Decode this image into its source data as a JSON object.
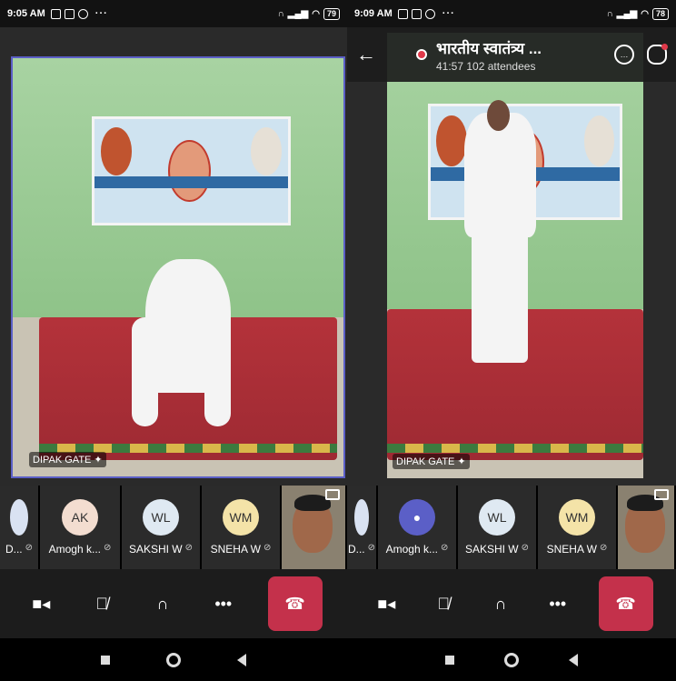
{
  "left": {
    "status": {
      "time": "9:05 AM",
      "battery": "79"
    },
    "video": {
      "name": "DIPAK GATE"
    },
    "participants": [
      {
        "initials": "",
        "name": "D...",
        "color": "#d9e2f2"
      },
      {
        "initials": "AK",
        "name": "Amogh k...",
        "color": "#f3ddd0"
      },
      {
        "initials": "WL",
        "name": "SAKSHI W",
        "color": "#dfe9f2"
      },
      {
        "initials": "WM",
        "name": "SNEHA W",
        "color": "#f4e3a8"
      }
    ]
  },
  "right": {
    "status": {
      "time": "9:09 AM",
      "battery": "78"
    },
    "meeting": {
      "title": "भारतीय स्वातंत्र्य ...",
      "duration": "41:57",
      "attendees": "102 attendees"
    },
    "video": {
      "name": "DIPAK GATE"
    },
    "participants": [
      {
        "initials": "",
        "name": "D...",
        "color": "#d9e2f2"
      },
      {
        "initials": "",
        "name": "Amogh k...",
        "color": "#5b5fc7"
      },
      {
        "initials": "WL",
        "name": "SAKSHI W",
        "color": "#dfe9f2"
      },
      {
        "initials": "WM",
        "name": "SNEHA W",
        "color": "#f4e3a8"
      }
    ]
  },
  "colors": {
    "accent": "#5b5fc7",
    "hangup": "#c4314b"
  }
}
